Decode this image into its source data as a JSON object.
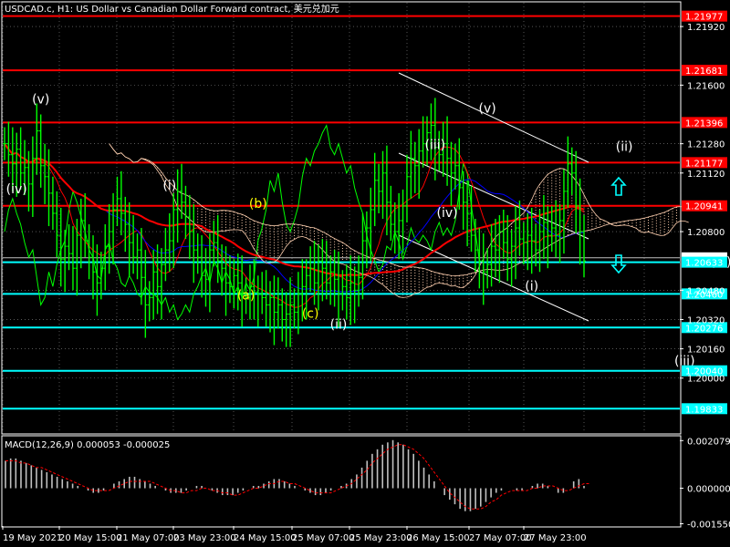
{
  "window": {
    "title": "USDCAD.c, H1:  US Dollar vs Canadian Dollar Forward contract, 美元兑加元"
  },
  "colors": {
    "background": "#000000",
    "grid": "#ffffff",
    "price_bar": "#00ff00",
    "resistance_line": "#ff0000",
    "support_line": "#00ffff",
    "label_red_bg": "#ff0000",
    "label_cyan_bg": "#00ffff",
    "moving_average": "#ff0000",
    "blue_line": "#0000ff",
    "cloud": "#ffd0b0",
    "channel": "#ffffff",
    "yellow_wave": "#ffff00",
    "macd_hist": "#c0c0c0",
    "macd_signal": "#ff0000"
  },
  "chart_data": {
    "type": "candlestick",
    "symbol": "USDCAD.c",
    "timeframe": "H1",
    "y_range": [
      1.197,
      1.2205
    ],
    "y_ticks": [
      "1.21920",
      "1.21600",
      "1.21280",
      "1.21120",
      "1.20800",
      "1.20480",
      "1.20320",
      "1.20160",
      "1.20000"
    ],
    "x_labels": [
      "19 May 2021",
      "20 May 15:00",
      "21 May 07:00",
      "23 May 23:00",
      "24 May 15:00",
      "25 May 07:00",
      "25 May 23:00",
      "26 May 15:00",
      "27 May 07:00",
      "27 May 23:00"
    ],
    "horizontal_levels": [
      {
        "value": 1.21977,
        "label": "1.21977",
        "kind": "resistance"
      },
      {
        "value": 1.21681,
        "label": "1.21681",
        "kind": "resistance"
      },
      {
        "value": 1.21396,
        "label": "1.21396",
        "kind": "resistance"
      },
      {
        "value": 1.21177,
        "label": "1.21177",
        "kind": "resistance"
      },
      {
        "value": 1.20941,
        "label": "1.20941",
        "kind": "resistance"
      },
      {
        "value": 1.20657,
        "label": "1.20657",
        "kind": "price"
      },
      {
        "value": 1.20633,
        "label": "1.20633",
        "kind": "support"
      },
      {
        "value": 1.2046,
        "label": "1.20460",
        "kind": "support"
      },
      {
        "value": 1.20276,
        "label": "1.20276",
        "kind": "support"
      },
      {
        "value": 1.2004,
        "label": "1.20040",
        "kind": "support"
      },
      {
        "value": 1.19833,
        "label": "1.19833",
        "kind": "support"
      }
    ],
    "close_series": [
      1.2128,
      1.2122,
      1.2117,
      1.2125,
      1.2112,
      1.2115,
      1.2106,
      1.212,
      1.2135,
      1.2116,
      1.211,
      1.2101,
      1.209,
      1.2078,
      1.2065,
      1.2072,
      1.2068,
      1.206,
      1.2078,
      1.2086,
      1.2075,
      1.2066,
      1.2058,
      1.2052,
      1.206,
      1.2072,
      1.208,
      1.2092,
      1.2098,
      1.209,
      1.2084,
      1.2074,
      1.2066,
      1.207,
      1.2055,
      1.204,
      1.2044,
      1.2058,
      1.205,
      1.2062,
      1.207,
      1.2075,
      1.2092,
      1.2102,
      1.2096,
      1.2088,
      1.208,
      1.207,
      1.2066,
      1.2056,
      1.2054,
      1.207,
      1.2074,
      1.2064,
      1.206,
      1.2052,
      1.205,
      1.2056,
      1.2052,
      1.2046,
      1.2044,
      1.205,
      1.2047,
      1.2046,
      1.2044,
      1.204,
      1.2044,
      1.2036,
      1.204,
      1.2032,
      1.2035,
      1.204,
      1.2036,
      1.2046,
      1.205,
      1.2056,
      1.206,
      1.2052,
      1.2064,
      1.206,
      1.2052,
      1.2058,
      1.2054,
      1.2046,
      1.205,
      1.2044,
      1.2052,
      1.2048,
      1.2055,
      1.2075,
      1.2082,
      1.2092,
      1.2108,
      1.2102,
      1.2112,
      1.2096,
      1.2084,
      1.208,
      1.2086,
      1.2094,
      1.211,
      1.212,
      1.2116,
      1.2124,
      1.2128,
      1.2134,
      1.2138,
      1.2126,
      1.2122,
      1.2128,
      1.212,
      1.2112,
      1.2116,
      1.2104,
      1.2096,
      1.209,
      1.2078,
      1.207,
      1.2064,
      1.2058,
      1.2062,
      1.2072,
      1.207,
      1.208,
      1.2074,
      1.2065,
      1.2072,
      1.2082,
      1.2076,
      1.2074,
      1.2078,
      1.2075,
      1.207,
      1.208,
      1.2085,
      1.2078,
      1.2082,
      1.2078,
      1.2086,
      1.2102,
      1.2117,
      1.2112,
      1.2094,
      1.208,
      1.2064
    ],
    "wave_labels": [
      {
        "text": "(v)",
        "color": "white",
        "at_index": 9,
        "at_price": 1.215
      },
      {
        "text": "(iv)",
        "color": "white",
        "at_index": 3,
        "at_price": 1.2101
      },
      {
        "text": "(i)",
        "color": "white",
        "at_index": 41,
        "at_price": 1.2103
      },
      {
        "text": "(b)",
        "color": "yellow",
        "at_index": 63,
        "at_price": 1.2093
      },
      {
        "text": "(a)",
        "color": "yellow",
        "at_index": 60,
        "at_price": 1.2043
      },
      {
        "text": "(c)",
        "color": "yellow",
        "at_index": 76,
        "at_price": 1.2033
      },
      {
        "text": "(ii)",
        "color": "white",
        "at_index": 83,
        "at_price": 1.2027
      },
      {
        "text": "(iii)",
        "color": "white",
        "at_index": 107,
        "at_price": 1.2125
      },
      {
        "text": "(iv)",
        "color": "white",
        "at_index": 110,
        "at_price": 1.2088
      },
      {
        "text": "(v)",
        "color": "white",
        "at_index": 120,
        "at_price": 1.2145
      },
      {
        "text": "(ii)",
        "color": "white",
        "at_index": 154,
        "at_price": 1.2124
      },
      {
        "text": "(i)",
        "color": "white",
        "at_index": 131,
        "at_price": 1.2048
      },
      {
        "text": "(iv)",
        "color": "white",
        "at_index": 178,
        "at_price": 1.2061
      },
      {
        "text": "(iii)",
        "color": "white",
        "at_index": 169,
        "at_price": 1.2007
      }
    ],
    "macd": {
      "label": "MACD(12,26,9) 0.000053 -0.000025",
      "y_ticks": [
        "0.002079",
        "0.000000",
        "-0.001550"
      ],
      "y_range": [
        -0.00165,
        0.00225
      ],
      "hist": [
        0.0012,
        0.0013,
        0.0013,
        0.0012,
        0.0011,
        0.001,
        0.0009,
        0.0008,
        0.0007,
        0.0006,
        0.0005,
        0.0004,
        0.0003,
        0.0002,
        0.0001,
        0.0,
        -0.0001,
        -0.0002,
        -0.0002,
        -0.0001,
        0.0,
        0.0002,
        0.0003,
        0.0004,
        0.0005,
        0.0005,
        0.0004,
        0.0003,
        0.0002,
        0.0001,
        0.0,
        -0.0001,
        -0.0002,
        -0.0002,
        -0.0002,
        -0.0001,
        0.0,
        0.0001,
        0.0001,
        0.0,
        -0.0001,
        -0.0002,
        -0.0003,
        -0.0003,
        -0.0003,
        -0.0002,
        -0.0001,
        0.0,
        0.0001,
        0.0001,
        0.0002,
        0.0003,
        0.0004,
        0.0004,
        0.0003,
        0.0002,
        0.0001,
        0.0,
        -0.0001,
        -0.0002,
        -0.0003,
        -0.0003,
        -0.0002,
        -0.0001,
        0.0,
        0.0001,
        0.0002,
        0.0004,
        0.0006,
        0.0009,
        0.0012,
        0.0015,
        0.0017,
        0.0019,
        0.002,
        0.0021,
        0.002,
        0.0019,
        0.0017,
        0.0015,
        0.0012,
        0.0009,
        0.0006,
        0.0003,
        0.0,
        -0.0003,
        -0.0005,
        -0.0007,
        -0.0009,
        -0.001,
        -0.001,
        -0.0009,
        -0.0008,
        -0.0006,
        -0.0004,
        -0.0002,
        -0.0001,
        0.0,
        0.0,
        -0.0001,
        -0.0001,
        0.0,
        0.0001,
        0.0002,
        0.0002,
        0.0001,
        0.0,
        -0.0002,
        -0.0002,
        0.0,
        0.0003,
        0.0004,
        0.0001
      ],
      "signal": [
        0.0012,
        0.0012,
        0.0012,
        0.0011,
        0.0011,
        0.001,
        0.0009,
        0.0009,
        0.0008,
        0.0007,
        0.0006,
        0.0005,
        0.0004,
        0.0003,
        0.0002,
        0.0001,
        0.0,
        -0.0001,
        -0.0001,
        -0.0001,
        -0.0001,
        0.0,
        0.0001,
        0.0002,
        0.0003,
        0.0003,
        0.0003,
        0.0003,
        0.0003,
        0.0002,
        0.0001,
        0.0,
        -0.0001,
        -0.0001,
        -0.0002,
        -0.0002,
        -0.0001,
        -0.0001,
        0.0,
        0.0,
        -0.0001,
        -0.0001,
        -0.0002,
        -0.0002,
        -0.0003,
        -0.0003,
        -0.0002,
        -0.0001,
        0.0,
        0.0,
        0.0001,
        0.0002,
        0.0002,
        0.0003,
        0.0003,
        0.0002,
        0.0002,
        0.0001,
        0.0,
        -0.0001,
        -0.0002,
        -0.0002,
        -0.0002,
        -0.0002,
        -0.0001,
        0.0,
        0.0001,
        0.0002,
        0.0004,
        0.0006,
        0.0008,
        0.0011,
        0.0013,
        0.0015,
        0.0017,
        0.0018,
        0.0019,
        0.0019,
        0.0018,
        0.0017,
        0.0015,
        0.0013,
        0.001,
        0.0007,
        0.0004,
        0.0001,
        -0.0002,
        -0.0004,
        -0.0006,
        -0.0008,
        -0.0009,
        -0.0009,
        -0.0009,
        -0.0008,
        -0.0006,
        -0.0005,
        -0.0003,
        -0.0002,
        -0.0001,
        -0.0001,
        -0.0001,
        -0.0001,
        0.0,
        0.0,
        0.0001,
        0.0001,
        0.0001,
        0.0,
        -0.0001,
        -0.0001,
        0.0,
        0.0001,
        0.0002,
        0.0002
      ]
    }
  }
}
